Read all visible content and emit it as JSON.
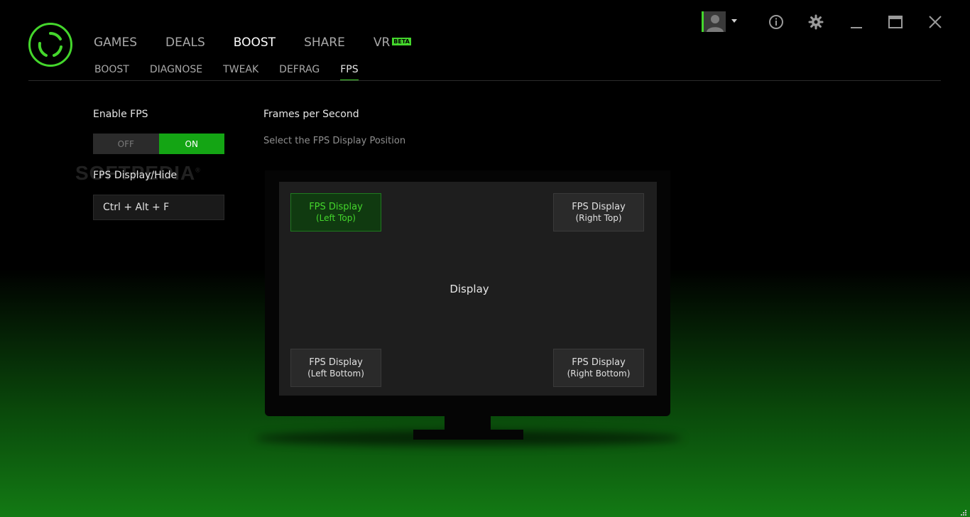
{
  "nav": {
    "main": [
      {
        "label": "GAMES"
      },
      {
        "label": "DEALS"
      },
      {
        "label": "BOOST",
        "active": true
      },
      {
        "label": "SHARE"
      },
      {
        "label": "VR",
        "badge": "BETA"
      }
    ],
    "sub": [
      {
        "label": "BOOST"
      },
      {
        "label": "DIAGNOSE"
      },
      {
        "label": "TWEAK"
      },
      {
        "label": "DEFRAG"
      },
      {
        "label": "FPS",
        "active": true
      }
    ]
  },
  "left_panel": {
    "enable_fps_label": "Enable FPS",
    "toggle": {
      "off_label": "OFF",
      "on_label": "ON",
      "state": "on"
    },
    "hotkey_label": "FPS Display/Hide",
    "hotkey_value": "Ctrl + Alt + F"
  },
  "watermark": {
    "text": "SOFTPEDIA",
    "mark": "®"
  },
  "fps_panel": {
    "title": "Frames per Second",
    "subtitle": "Select the FPS Display Position",
    "display_label": "Display",
    "positions": {
      "left_top": {
        "line1": "FPS Display",
        "line2": "(Left Top)",
        "selected": true
      },
      "right_top": {
        "line1": "FPS Display",
        "line2": "(Right Top)"
      },
      "left_bottom": {
        "line1": "FPS Display",
        "line2": "(Left Bottom)"
      },
      "right_bottom": {
        "line1": "FPS Display",
        "line2": "(Right Bottom)"
      }
    }
  },
  "colors": {
    "accent": "#44d62c",
    "toggle_on": "#14a514",
    "selected_bg": "#103a10"
  },
  "icons": [
    "razer-logo-icon",
    "user-avatar-icon",
    "caret-down-icon",
    "info-icon",
    "gear-icon",
    "minimize-icon",
    "maximize-icon",
    "close-icon"
  ]
}
